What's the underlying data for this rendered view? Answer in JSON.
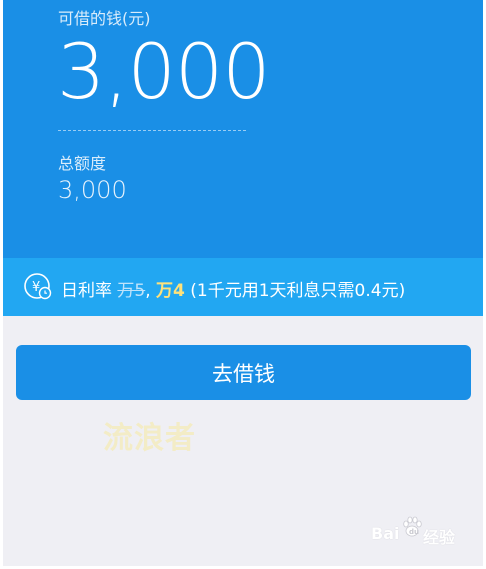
{
  "hero": {
    "available_label": "可借的钱(元)",
    "available_amount": "3,000",
    "total_label": "总额度",
    "total_amount": "3,000"
  },
  "rate": {
    "prefix": "日利率",
    "old_rate": "万5",
    "new_rate": "万4",
    "note": "(1千元用1天利息只需0.4元)",
    "icon": "yen-clock-icon"
  },
  "borrow_button_label": "去借钱",
  "watermark_user": "流浪者",
  "baidu_watermark": {
    "brand": "Bai",
    "suffix": "经验",
    "icon": "baidu-paw-icon"
  },
  "colors": {
    "hero_bg": "#1a8fe6",
    "rate_bg": "#22a7f2",
    "page_bg": "#efeff4",
    "new_rate": "#ffe27a"
  }
}
